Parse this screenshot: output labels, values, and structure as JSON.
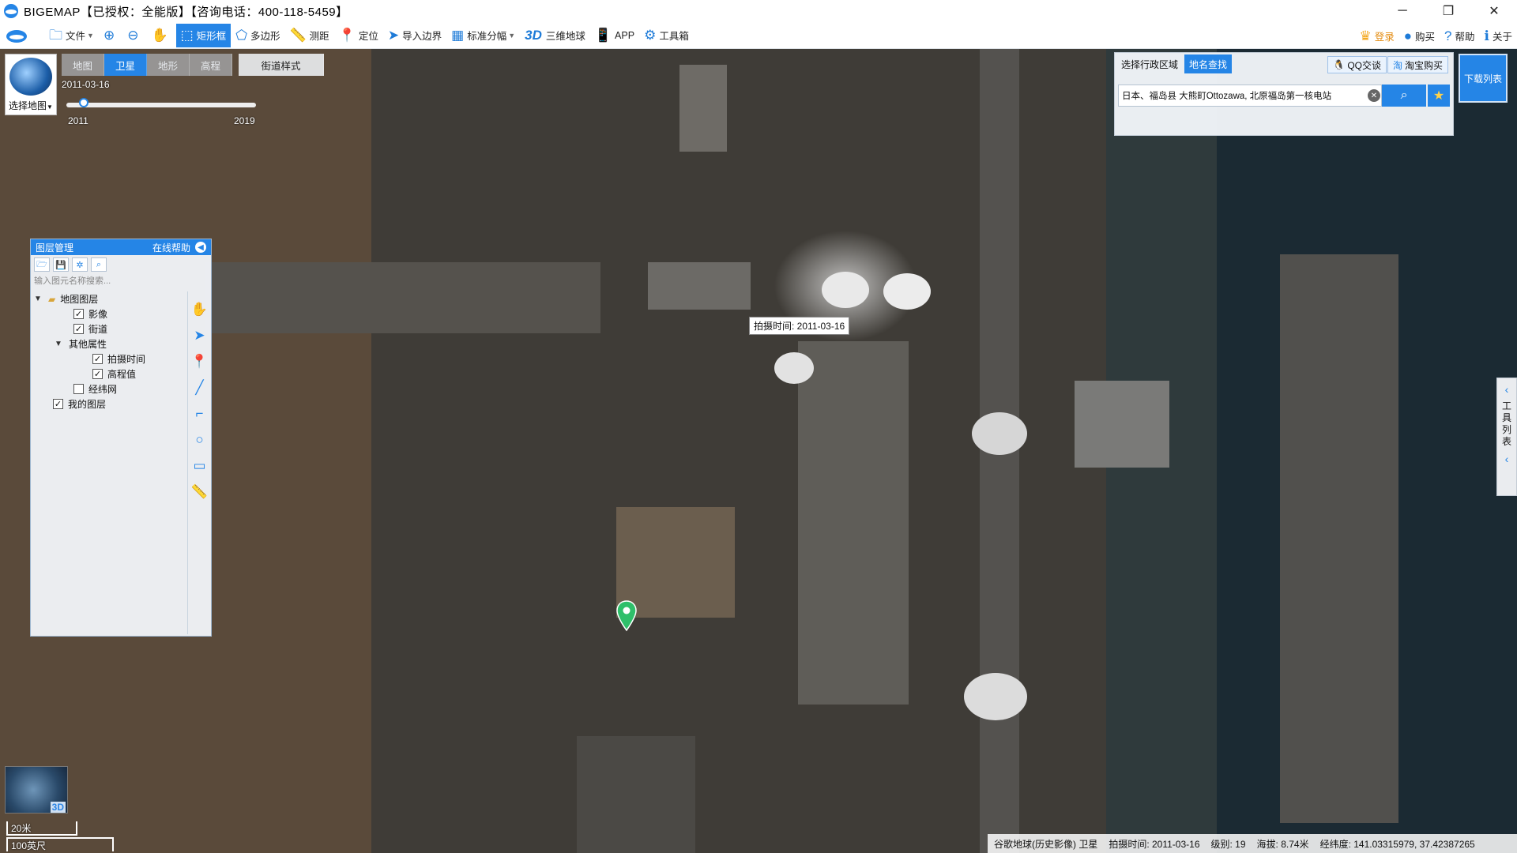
{
  "window": {
    "title": "BIGEMAP【已授权：全能版】【咨询电话：400-118-5459】",
    "controls": [
      "─",
      "❐",
      "✕"
    ]
  },
  "toolbar": {
    "items": [
      {
        "label": "文件",
        "icon": "folder-icon"
      },
      {
        "label": "",
        "icon": "zoom-in-icon"
      },
      {
        "label": "",
        "icon": "zoom-out-icon"
      },
      {
        "label": "",
        "icon": "pan-hand-icon"
      },
      {
        "label": "矩形框",
        "icon": "rectangle-select-icon",
        "active": true
      },
      {
        "label": "多边形",
        "icon": "polygon-icon"
      },
      {
        "label": "测距",
        "icon": "ruler-icon"
      },
      {
        "label": "定位",
        "icon": "location-pin-icon"
      },
      {
        "label": "导入边界",
        "icon": "import-boundary-icon"
      },
      {
        "label": "标准分幅",
        "icon": "grid-icon"
      },
      {
        "label": "三维地球",
        "icon": "3d-icon"
      },
      {
        "label": "APP",
        "icon": "phone-icon"
      },
      {
        "label": "工具箱",
        "icon": "gear-icon"
      }
    ],
    "right_items": [
      {
        "label": "登录",
        "icon": "login-icon"
      },
      {
        "label": "购买",
        "icon": "buy-icon"
      },
      {
        "label": "帮助",
        "icon": "help-icon"
      },
      {
        "label": "关于",
        "icon": "info-icon"
      }
    ],
    "three_d_text": "3D"
  },
  "basemap": {
    "select_label": "选择地图",
    "tabs": [
      "地图",
      "卫星",
      "地形",
      "高程"
    ],
    "active_tab": "卫星",
    "street_style": "街道样式",
    "timeline": {
      "date": "2011-03-16",
      "start_year": "2011",
      "end_year": "2019"
    }
  },
  "layer_panel": {
    "title": "图层管理",
    "help": "在线帮助",
    "search_placeholder": "输入图元名称搜索...",
    "tree": [
      {
        "label": "地图图层",
        "level": 0,
        "expanded": true,
        "type": "folder"
      },
      {
        "label": "影像",
        "level": 1,
        "checked": true
      },
      {
        "label": "街道",
        "level": 1,
        "checked": true
      },
      {
        "label": "其他属性",
        "level": 1,
        "expanded": true,
        "type": "group"
      },
      {
        "label": "拍摄时间",
        "level": 2,
        "checked": true
      },
      {
        "label": "高程值",
        "level": 2,
        "checked": true
      },
      {
        "label": "经纬网",
        "level": 1,
        "checked": false
      },
      {
        "label": "我的图层",
        "level": 0,
        "checked": true
      }
    ]
  },
  "search_panel": {
    "tabs": [
      "选择行政区域",
      "地名查找"
    ],
    "active_tab": "地名查找",
    "qq_label": "QQ交谈",
    "taobao_label": "淘宝购买",
    "query": "日本、福岛县 大熊町Ottozawa, 北原福岛第一核电站"
  },
  "download_list": "下载列表",
  "tool_list": "工具列表",
  "map": {
    "tooltip": "拍摄时间: 2011-03-16",
    "scale_metric": "20米",
    "scale_imperial": "100英尺",
    "minimap_label": "3D"
  },
  "status": {
    "source": "谷歌地球(历史影像) 卫星",
    "capture_time": "拍摄时间: 2011-03-16",
    "level": "级别: 19",
    "altitude": "海拔: 8.74米",
    "coords": "经纬度: 141.03315979, 37.42387265"
  },
  "colors": {
    "accent": "#2585e6"
  }
}
